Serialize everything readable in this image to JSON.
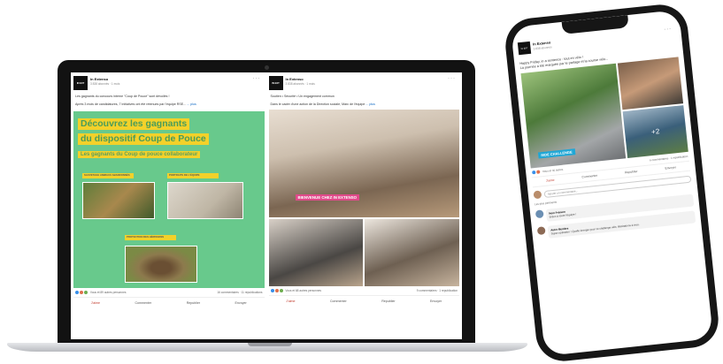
{
  "laptop": {
    "left_post": {
      "org": "In Extenso",
      "sub": "3 838 abonnés · 1 mois",
      "text1": "Les gagnants du concours interne \"Coup de Pouce\" sont dévoilés !",
      "text2": "Après 3 mois de candidatures, 7 initiatives ont été retenues par l'équipe RSE...",
      "more": "... plus",
      "image_title_1": "Découvrez les gagnants",
      "image_title_2": "du dispositif Coup de Pouce",
      "image_sub": "Les gagnants du Coup de pouce collaborateur",
      "cap_fox": "SAUVETAGE ANIMAUX ABANDONNÉS",
      "cap_cards": "PORTRAITS DE L'ÉQUIPE",
      "cap_hedge": "PROTECTION DES HÉRISSONS",
      "reactions": "Vous et 89 autres personnes",
      "counts": "16 commentaires · 11 republications",
      "actions": [
        "J'aime",
        "Commenter",
        "Republier",
        "Envoyer"
      ]
    },
    "right_post": {
      "org": "In Extenso",
      "sub": "3 838 abonnés · 1 mois",
      "text1": "Soutien • Sécurité • Un engagement commun",
      "text2": "Dans le cadre d'une action de la Direction sociale, Marc de l'équipe",
      "more": "... plus",
      "banner": "BIENVENUE CHEZ IN EXTENSO",
      "reactions": "Vous et 68 autres personnes",
      "counts": "9 commentaires · 1 republication",
      "actions": [
        "J'aime",
        "Commenter",
        "Republier",
        "Envoyer"
      ]
    }
  },
  "phone": {
    "org": "In Extenso",
    "sub": "3 838 abonnés",
    "text1": "Happy Friday, in a sentence : tout en vélo !",
    "text2": "La journée a été marquée par le partage et la course vélo...",
    "badge": "+2",
    "banner": "RIDE CHALLENGE",
    "reactions": "Vous et 46 autres",
    "counts": "6 commentaires · 1 republication",
    "actions": [
      "J'aime",
      "Commenter",
      "Republier",
      "Envoyer"
    ],
    "comment_placeholder": "Ajouter un commentaire...",
    "sort": "Les plus pertinents",
    "comment1_name": "Nom Prénom",
    "comment1_text": "Bravo à toute l'équipe !",
    "comment2_name": "Autre Membre",
    "comment2_text": "Super opération ! Quelle énergie pour ce challenge vélo, félicitations à tous."
  },
  "colors": {
    "green_bg": "#68c98c",
    "yellow_band": "#f3d12a",
    "pink_banner": "#e04a8a",
    "blue_banner": "#1fa7d6",
    "linkedin_blue": "#0a66c2"
  }
}
